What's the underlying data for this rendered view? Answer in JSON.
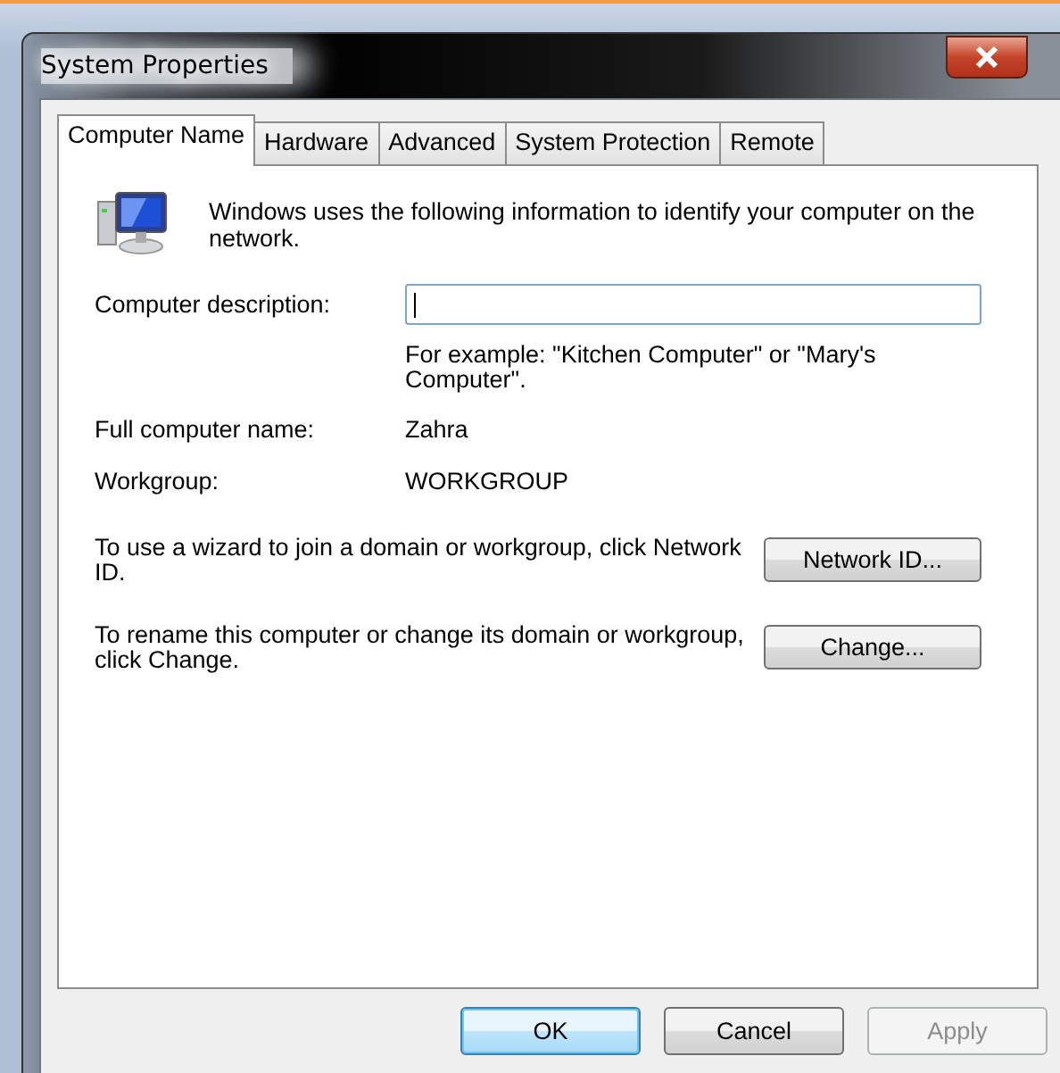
{
  "window": {
    "title": "System Properties"
  },
  "tabs": [
    {
      "label": "Computer Name",
      "selected": true
    },
    {
      "label": "Hardware",
      "selected": false
    },
    {
      "label": "Advanced",
      "selected": false
    },
    {
      "label": "System Protection",
      "selected": false
    },
    {
      "label": "Remote",
      "selected": false
    }
  ],
  "intro": "Windows uses the following information to identify your computer on the network.",
  "description": {
    "label": "Computer description:",
    "hint": "For example: \"Kitchen Computer\" or \"Mary's Computer\"."
  },
  "info_rows": [
    {
      "label": "Full computer name:",
      "value": "Zahra"
    },
    {
      "label": "Workgroup:",
      "value": "WORKGROUP"
    }
  ],
  "actions": [
    {
      "text": "To use a wizard to join a domain or workgroup, click Network ID.",
      "button": "Network ID..."
    },
    {
      "text": "To rename this computer or change its domain or workgroup, click Change.",
      "button": "Change..."
    }
  ],
  "buttons": [
    {
      "label": "OK",
      "default": true,
      "disabled": false
    },
    {
      "label": "Cancel",
      "default": false,
      "disabled": false
    },
    {
      "label": "Apply",
      "default": false,
      "disabled": true
    }
  ]
}
